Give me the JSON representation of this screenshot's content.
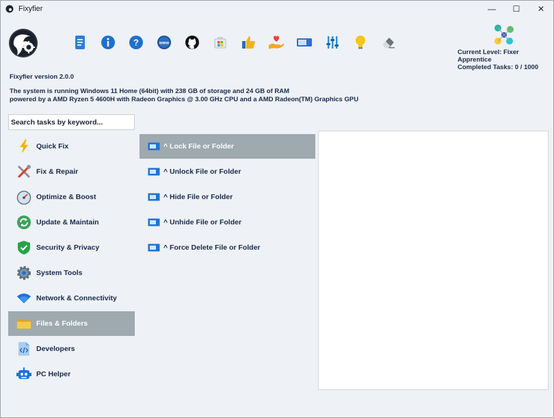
{
  "window": {
    "title": "Fixyfier",
    "minimize_glyph": "—",
    "maximize_glyph": "☐",
    "close_glyph": "✕"
  },
  "toolbar": [
    {
      "icon": "document-icon",
      "color": "#2b7fd4"
    },
    {
      "icon": "info-icon",
      "color": "#1f6fd0"
    },
    {
      "icon": "help-icon",
      "color": "#1f6fd0"
    },
    {
      "icon": "www-icon",
      "color": "#1f4f9a"
    },
    {
      "icon": "github-icon",
      "color": "#111111"
    },
    {
      "icon": "windows-store-icon",
      "color": "#7aa34a"
    },
    {
      "icon": "thumbs-up-icon",
      "color": "#f2b21b"
    },
    {
      "icon": "heart-hand-icon",
      "color": "#e8453c"
    },
    {
      "icon": "window-toggle-icon",
      "color": "#2c6fd6"
    },
    {
      "icon": "sliders-icon",
      "color": "#2c8fd6"
    },
    {
      "icon": "lightbulb-icon",
      "color": "#f5c518"
    },
    {
      "icon": "eraser-icon",
      "color": "#777777"
    }
  ],
  "level": {
    "current": "Current Level: Fixer Apprentice",
    "completed": "Completed Tasks: 0 / 1000"
  },
  "info": {
    "version": "Fixyfier version 2.0.0",
    "line1": "The system is running Windows 11 Home (64bit) with 238 GB of storage and 24 GB of RAM",
    "line2": "powered by a AMD Ryzen 5 4600H with Radeon Graphics @ 3.00 GHz CPU and a AMD Radeon(TM) Graphics GPU"
  },
  "search": {
    "placeholder": "Search tasks by keyword..."
  },
  "sidebar": {
    "items": [
      {
        "label": "Quick Fix",
        "icon": "lightning-icon"
      },
      {
        "label": "Fix & Repair",
        "icon": "tools-icon"
      },
      {
        "label": "Optimize & Boost",
        "icon": "speedometer-icon"
      },
      {
        "label": "Update & Maintain",
        "icon": "refresh-icon"
      },
      {
        "label": "Security & Privacy",
        "icon": "shield-icon"
      },
      {
        "label": "System Tools",
        "icon": "gear-icon"
      },
      {
        "label": "Network & Connectivity",
        "icon": "wifi-icon"
      },
      {
        "label": "Files & Folders",
        "icon": "folder-icon"
      },
      {
        "label": "Developers",
        "icon": "code-file-icon"
      },
      {
        "label": "PC Helper",
        "icon": "robot-icon"
      }
    ],
    "active_index": 7
  },
  "tasks": {
    "items": [
      {
        "label": "^ Lock File or Folder"
      },
      {
        "label": "^ Unlock File or Folder"
      },
      {
        "label": "^ Hide File or Folder"
      },
      {
        "label": "^ Unhide File or Folder"
      },
      {
        "label": "^ Force Delete File or Folder"
      }
    ],
    "active_index": 0
  }
}
